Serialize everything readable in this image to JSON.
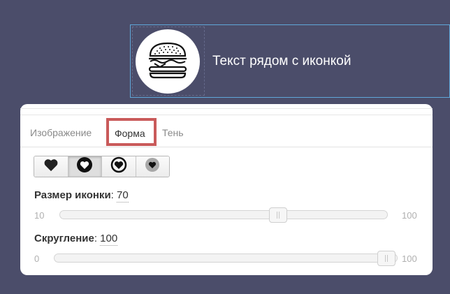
{
  "preview": {
    "icon": "burger-icon",
    "text": "Текст рядом с иконкой"
  },
  "tabs": [
    {
      "label": "Изображение"
    },
    {
      "label": "Форма"
    },
    {
      "label": "Тень"
    }
  ],
  "active_tab": "Форма",
  "shapes": [
    {
      "icon": "heart-solid-icon"
    },
    {
      "icon": "heart-circle-icon"
    },
    {
      "icon": "heart-ring-icon"
    },
    {
      "icon": "heart-grey-circle-icon"
    }
  ],
  "selected_shape": "heart-circle-icon",
  "size_slider": {
    "label": "Размер иконки",
    "value": "70",
    "min": "10",
    "max": "100"
  },
  "round_slider": {
    "label": "Скругление",
    "value": "100",
    "min": "0",
    "max": "100"
  },
  "colors": {
    "background": "#4b4d6a",
    "accent_border": "#c95a5a",
    "preview_border": "#5fa7d9"
  }
}
